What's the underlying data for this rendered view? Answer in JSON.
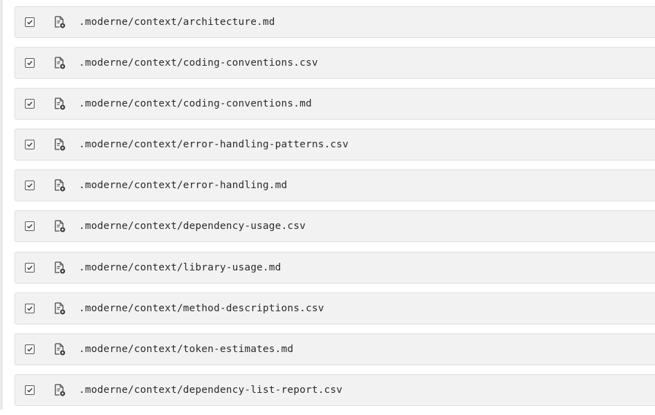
{
  "files": [
    {
      "path": ".moderne/context/architecture.md",
      "checked": true
    },
    {
      "path": ".moderne/context/coding-conventions.csv",
      "checked": true
    },
    {
      "path": ".moderne/context/coding-conventions.md",
      "checked": true
    },
    {
      "path": ".moderne/context/error-handling-patterns.csv",
      "checked": true
    },
    {
      "path": ".moderne/context/error-handling.md",
      "checked": true
    },
    {
      "path": ".moderne/context/dependency-usage.csv",
      "checked": true
    },
    {
      "path": ".moderne/context/library-usage.md",
      "checked": true
    },
    {
      "path": ".moderne/context/method-descriptions.csv",
      "checked": true
    },
    {
      "path": ".moderne/context/token-estimates.md",
      "checked": true
    },
    {
      "path": ".moderne/context/dependency-list-report.csv",
      "checked": true
    }
  ],
  "icons": {
    "checkbox": "checkbox-checked-icon",
    "file": "file-added-icon"
  }
}
